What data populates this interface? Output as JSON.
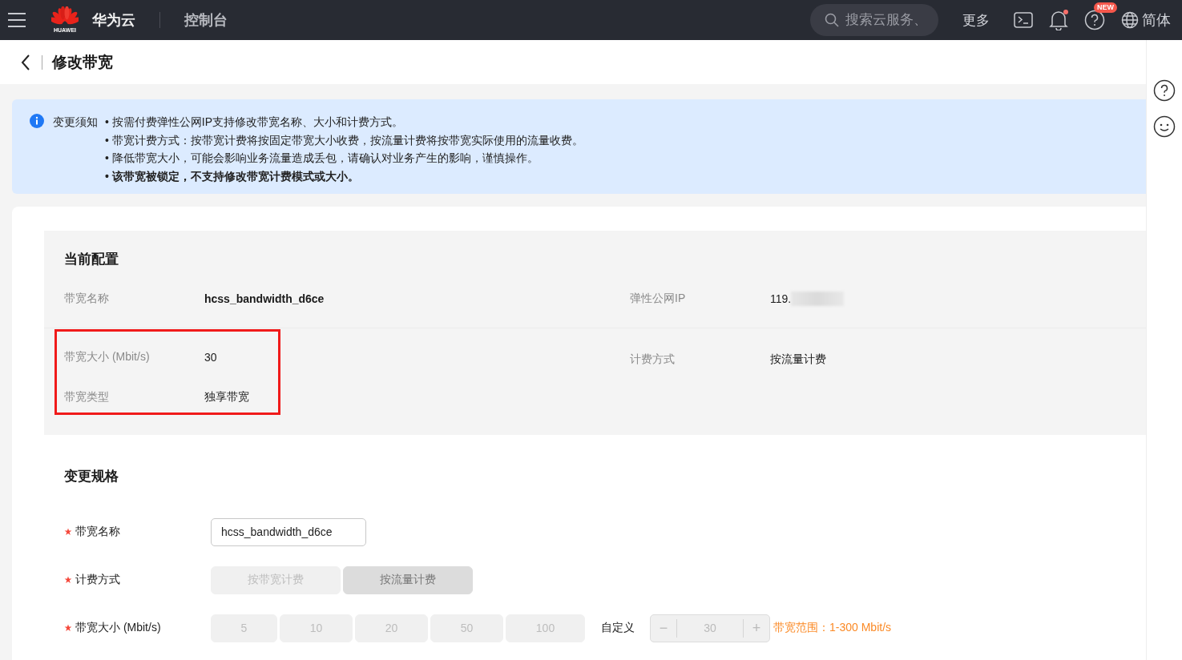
{
  "topbar": {
    "logo_text": "HUAWEI",
    "brand": "华为云",
    "console": "控制台",
    "search": {
      "placeholder": "搜索云服务、"
    },
    "more": "更多",
    "notification_dot": true,
    "new_badge": "NEW",
    "language": "简体"
  },
  "page": {
    "title": "修改带宽"
  },
  "notice": {
    "heading": "变更须知",
    "items": [
      {
        "text": "• 按需付费弹性公网IP支持修改带宽名称、大小和计费方式。",
        "bold": false
      },
      {
        "text": "• 带宽计费方式：按带宽计费将按固定带宽大小收费，按流量计费将按带宽实际使用的流量收费。",
        "bold": false
      },
      {
        "text": "• 降低带宽大小，可能会影响业务流量造成丢包，请确认对业务产生的影响，谨慎操作。",
        "bold": false
      },
      {
        "text": "• 该带宽被锁定，不支持修改带宽计费模式或大小。",
        "bold": true
      }
    ]
  },
  "current_config": {
    "title": "当前配置",
    "left": [
      {
        "label": "带宽名称",
        "value": "hcss_bandwidth_d6ce",
        "bold": true,
        "highlighted": false
      },
      {
        "label": "带宽大小 (Mbit/s)",
        "value": "30",
        "bold": false,
        "highlighted": true
      },
      {
        "label": "带宽类型",
        "value": "独享带宽",
        "bold": false,
        "highlighted": true
      }
    ],
    "right": [
      {
        "label": "弹性公网IP",
        "value": "119.",
        "redacted": true
      },
      {
        "label": "计费方式",
        "value": "按流量计费",
        "redacted": false
      }
    ]
  },
  "change_spec": {
    "title": "变更规格",
    "name": {
      "label": "带宽名称",
      "required": true,
      "value": "hcss_bandwidth_d6ce"
    },
    "billing": {
      "label": "计费方式",
      "required": true,
      "options": [
        {
          "label": "按带宽计费",
          "selected": false,
          "disabled": true
        },
        {
          "label": "按流量计费",
          "selected": true,
          "disabled": true
        }
      ]
    },
    "size": {
      "label": "带宽大小 (Mbit/s)",
      "required": true,
      "options": [
        {
          "label": "5",
          "selected": false,
          "disabled": true
        },
        {
          "label": "10",
          "selected": false,
          "disabled": true
        },
        {
          "label": "20",
          "selected": false,
          "disabled": true
        },
        {
          "label": "50",
          "selected": false,
          "disabled": true
        },
        {
          "label": "100",
          "selected": false,
          "disabled": true
        }
      ],
      "custom_label": "自定义",
      "stepper": {
        "minus": "−",
        "value": "30",
        "plus": "+",
        "disabled": true
      },
      "hint": "带宽范围：1-300 Mbit/s"
    }
  }
}
